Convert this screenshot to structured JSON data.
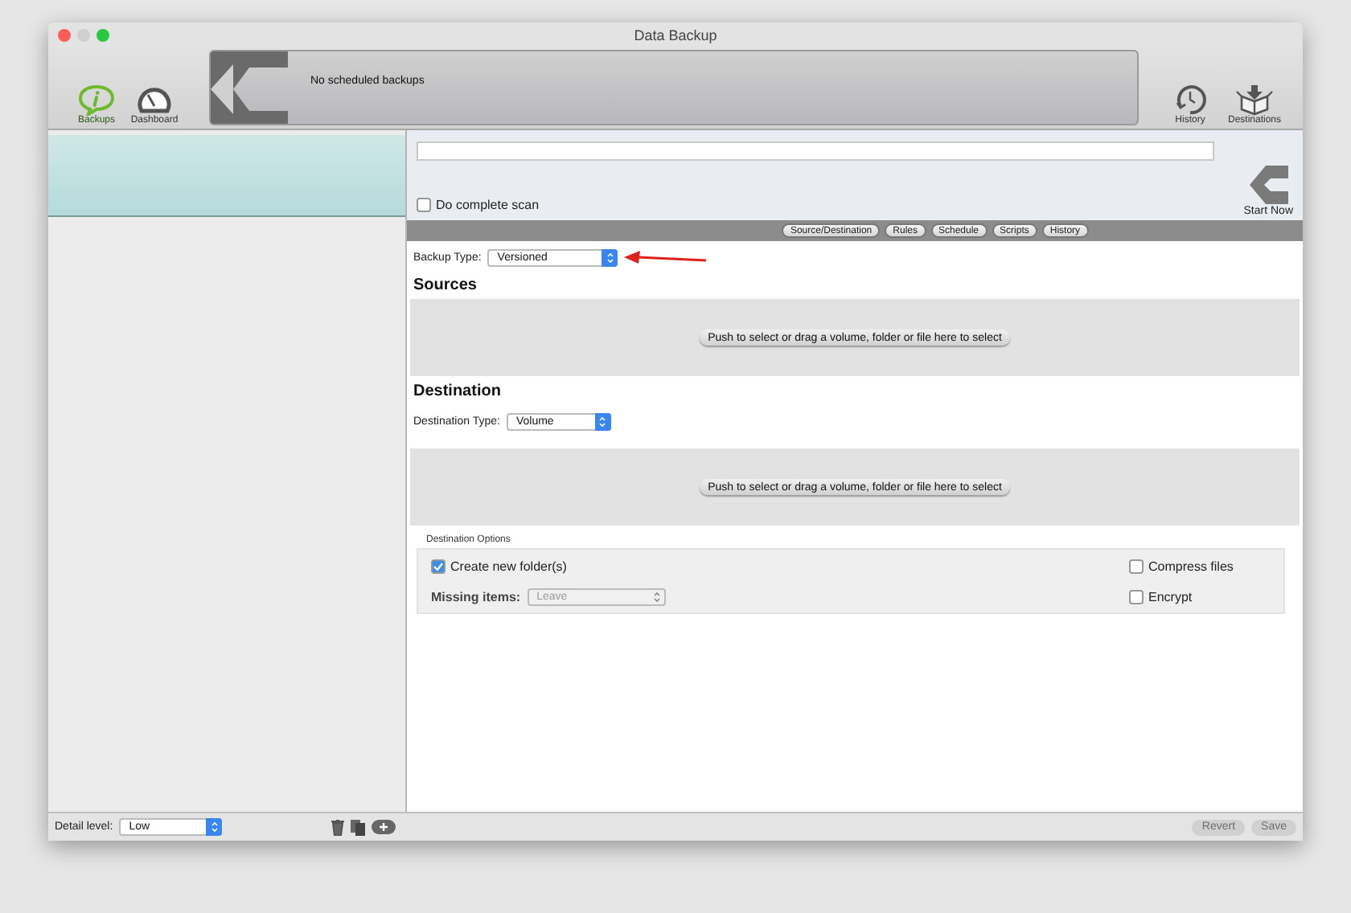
{
  "window": {
    "title": "Data Backup"
  },
  "toolbar": {
    "left_items": [
      {
        "kind": "backups",
        "label": "Backups",
        "selected": true
      },
      {
        "kind": "dashboard",
        "label": "Dashboard",
        "selected": false
      }
    ],
    "banner": {
      "message": "No scheduled backups"
    },
    "right_items": [
      {
        "kind": "history",
        "label": "History"
      },
      {
        "kind": "destinations",
        "label": "Destinations"
      }
    ]
  },
  "task": {
    "complete_scan": {
      "label": "Do complete scan",
      "checked": false
    },
    "start_button": "Start Now"
  },
  "tabs": [
    {
      "label": "Source/Destination"
    },
    {
      "label": "Rules"
    },
    {
      "label": "Schedule"
    },
    {
      "label": "Scripts"
    },
    {
      "label": "History"
    }
  ],
  "backup_type": {
    "label": "Backup Type:",
    "value": "Versioned"
  },
  "sources": {
    "heading": "Sources",
    "drop_button": "Push to select or drag a volume, folder or file here to select"
  },
  "destination": {
    "heading": "Destination",
    "type_label": "Destination Type:",
    "type_value": "Volume",
    "drop_button": "Push to select or drag a volume, folder or file here to select"
  },
  "destination_options": {
    "title": "Destination Options",
    "create_folders": {
      "label": "Create new folder(s)",
      "checked": true
    },
    "missing_items": {
      "label": "Missing items:",
      "value": "Leave",
      "disabled": true
    },
    "compress": {
      "label": "Compress files",
      "checked": false
    },
    "encrypt": {
      "label": "Encrypt",
      "checked": false
    }
  },
  "footer": {
    "detail_label": "Detail level:",
    "detail_value": "Low",
    "buttons": [
      {
        "label": "Revert",
        "disabled": true
      },
      {
        "label": "Save",
        "disabled": true
      }
    ]
  }
}
